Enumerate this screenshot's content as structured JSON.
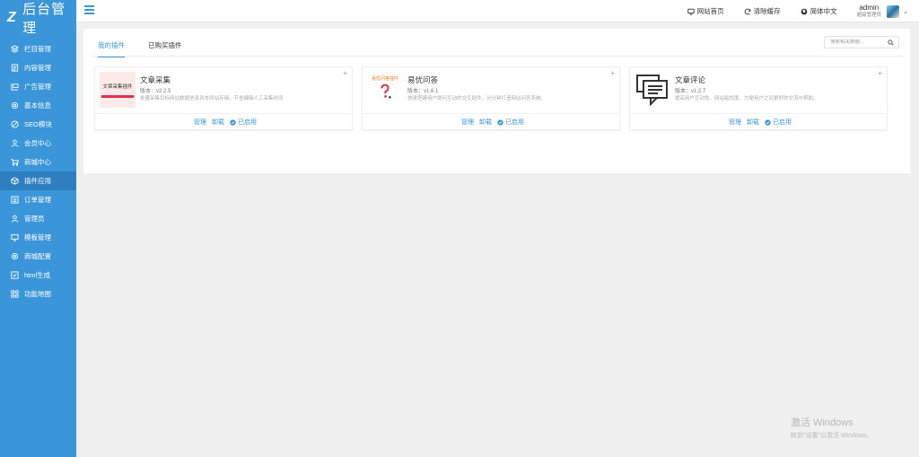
{
  "app": {
    "title": "后台管理"
  },
  "sidebar": {
    "items": [
      {
        "label": "栏目管理",
        "icon": "layers-icon"
      },
      {
        "label": "内容管理",
        "icon": "document-icon"
      },
      {
        "label": "广告管理",
        "icon": "billboard-icon"
      },
      {
        "label": "基本信息",
        "icon": "gear-icon"
      },
      {
        "label": "SEO模块",
        "icon": "ban-icon"
      },
      {
        "label": "会员中心",
        "icon": "user-icon"
      },
      {
        "label": "商城中心",
        "icon": "cart-icon"
      },
      {
        "label": "插件应用",
        "icon": "cube-icon"
      },
      {
        "label": "订单管理",
        "icon": "list-icon"
      },
      {
        "label": "管理员",
        "icon": "admin-icon"
      },
      {
        "label": "模板管理",
        "icon": "monitor-icon"
      },
      {
        "label": "商城配置",
        "icon": "settings-icon"
      },
      {
        "label": "html生成",
        "icon": "check-square-icon"
      },
      {
        "label": "功能地图",
        "icon": "grid-icon"
      }
    ],
    "active_index": 7
  },
  "topbar": {
    "links": [
      {
        "label": "网站首页",
        "icon": "monitor-icon"
      },
      {
        "label": "清除缓存",
        "icon": "refresh-icon"
      },
      {
        "label": "简体中文",
        "icon": "globe-icon"
      }
    ],
    "user": {
      "name": "admin",
      "role": "超级管理员"
    }
  },
  "plugins": {
    "tabs": [
      {
        "label": "我的插件",
        "active": true
      },
      {
        "label": "已购买插件",
        "active": false
      }
    ],
    "search_placeholder": "搜索相关数据...",
    "cards": [
      {
        "title": "文章采集",
        "version": "版本：v2.2.5",
        "desc": "批量采集目标网站数据信息到本网站存储，节省编辑人工采集时间",
        "thumb_text": "文章采集插件",
        "manage": "管理",
        "uninstall": "卸载",
        "status": "已启用"
      },
      {
        "title": "易优问答",
        "version": "版本：v1.6.1",
        "desc": "快速搭建用户提问互动的交互插件，分分钟打造网站问答系统。",
        "thumb_text": "易优问答插件",
        "manage": "管理",
        "uninstall": "卸载",
        "status": "已启用"
      },
      {
        "title": "文章评论",
        "version": "版本：v1.2.7",
        "desc": "提高用户互动性、网站粘性度、方便用户之间更好的交流与帮助。",
        "thumb_text": "",
        "manage": "管理",
        "uninstall": "卸载",
        "status": "已启用"
      }
    ]
  },
  "watermark": {
    "line1": "激活 Windows",
    "line2": "转到\"设置\"以激活 Windows。"
  },
  "colors": {
    "accent": "#3a96d8",
    "sidebar_active": "#2e7fbf"
  }
}
